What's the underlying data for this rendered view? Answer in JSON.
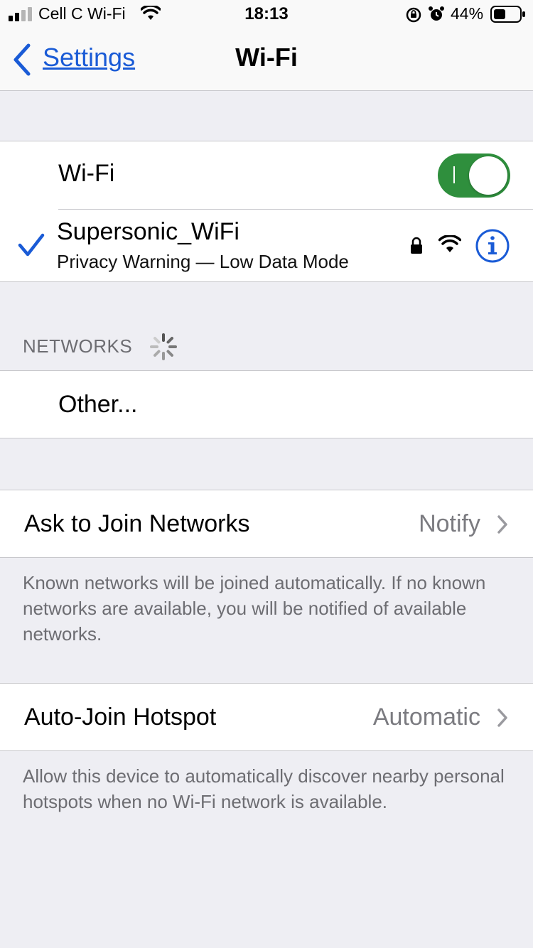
{
  "status_bar": {
    "carrier": "Cell C Wi-Fi",
    "time": "18:13",
    "battery_percent": "44%"
  },
  "nav": {
    "back_label": "Settings",
    "title": "Wi-Fi"
  },
  "wifi_group": {
    "wifi_label": "Wi-Fi",
    "wifi_toggle_on": true,
    "connected_network": {
      "name": "Supersonic_WiFi",
      "subtitle": "Privacy Warning — Low Data Mode"
    }
  },
  "networks_section": {
    "header": "NETWORKS",
    "other_label": "Other..."
  },
  "ask_to_join": {
    "label": "Ask to Join Networks",
    "value": "Notify",
    "footer": "Known networks will be joined automatically. If no known networks are available, you will be notified of available networks."
  },
  "auto_join_hotspot": {
    "label": "Auto-Join Hotspot",
    "value": "Automatic",
    "footer": "Allow this device to automatically discover nearby personal hotspots when no Wi-Fi network is available."
  },
  "colors": {
    "accent": "#1a5bd6",
    "toggle_on": "#2f8f3d",
    "background": "#eeeef3"
  }
}
